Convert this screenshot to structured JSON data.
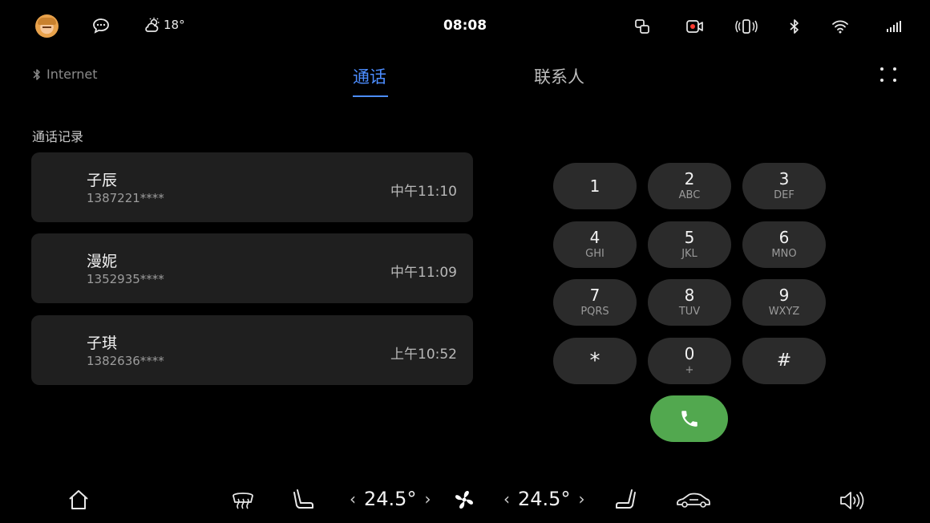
{
  "status_bar": {
    "weather_temp": "18°",
    "time": "08:08"
  },
  "header": {
    "bluetooth_label": "Internet",
    "tabs": [
      {
        "label": "通话",
        "active": true
      },
      {
        "label": "联系人",
        "active": false
      }
    ]
  },
  "recent_calls": {
    "title": "通话记录",
    "items": [
      {
        "name": "子辰",
        "number": "1387221****",
        "time": "中午11:10"
      },
      {
        "name": "漫妮",
        "number": "1352935****",
        "time": "中午11:09"
      },
      {
        "name": "子琪",
        "number": "1382636****",
        "time": "上午10:52"
      }
    ]
  },
  "keypad": {
    "keys": [
      {
        "main": "1",
        "sub": ""
      },
      {
        "main": "2",
        "sub": "ABC"
      },
      {
        "main": "3",
        "sub": "DEF"
      },
      {
        "main": "4",
        "sub": "GHI"
      },
      {
        "main": "5",
        "sub": "JKL"
      },
      {
        "main": "6",
        "sub": "MNO"
      },
      {
        "main": "7",
        "sub": "PQRS"
      },
      {
        "main": "8",
        "sub": "TUV"
      },
      {
        "main": "9",
        "sub": "WXYZ"
      },
      {
        "main": "*",
        "sub": ""
      },
      {
        "main": "0",
        "sub": "+"
      },
      {
        "main": "#",
        "sub": ""
      }
    ],
    "call_icon": "phone-icon",
    "call_color": "#52a84f"
  },
  "climate": {
    "left_temp": "24.5°",
    "right_temp": "24.5°"
  },
  "colors": {
    "accent": "#4c8dff",
    "background": "#000000",
    "card": "#1f1f1f",
    "key": "#2b2b2b"
  }
}
